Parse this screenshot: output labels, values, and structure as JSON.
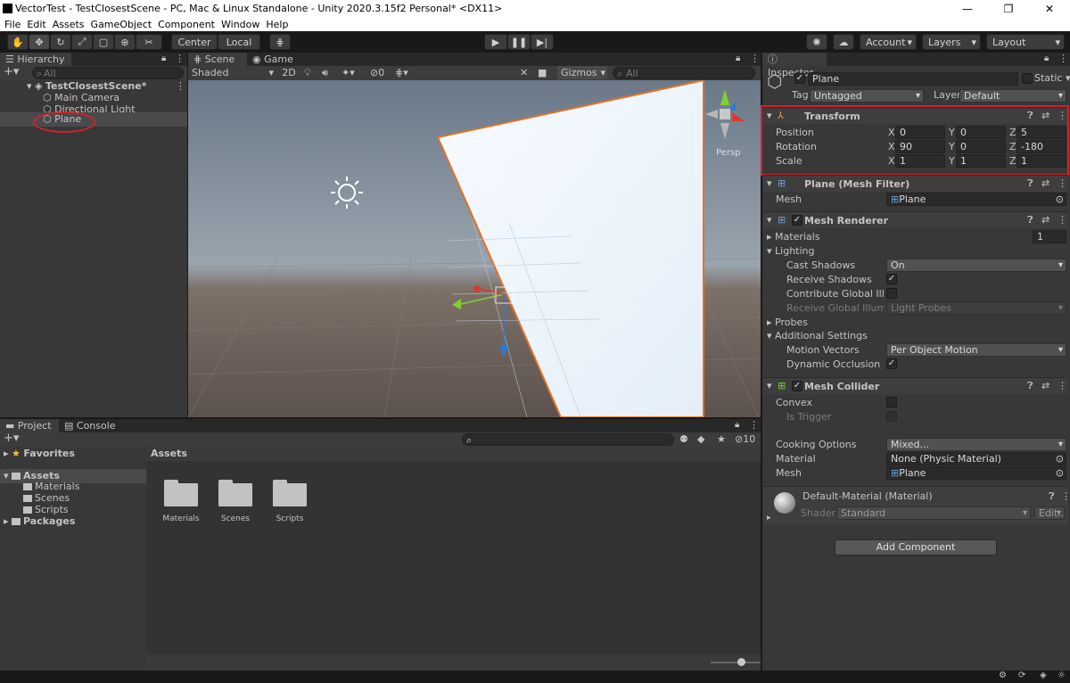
{
  "window": {
    "title": "VectorTest - TestClosestScene - PC, Mac & Linux Standalone - Unity 2020.3.15f2 Personal* <DX11>",
    "controls": [
      "—",
      "❐",
      "✕"
    ]
  },
  "menu": [
    "File",
    "Edit",
    "Assets",
    "GameObject",
    "Component",
    "Window",
    "Help"
  ],
  "toolbar": {
    "pivot": "Center",
    "space": "Local",
    "account": "Account",
    "layers": "Layers",
    "layout": "Layout"
  },
  "hierarchy": {
    "tab": "Hierarchy",
    "search_placeholder": "All",
    "scene": "TestClosestScene*",
    "items": [
      "Main Camera",
      "Directional Light",
      "Plane"
    ]
  },
  "scene_view": {
    "tabs": [
      "Scene",
      "Game"
    ],
    "draw_mode": "Shaded",
    "mode_2d": "2D",
    "hidden_count": "0",
    "gizmos": "Gizmos",
    "search_placeholder": "All",
    "persp": "Persp"
  },
  "project": {
    "tabs": [
      "Project",
      "Console"
    ],
    "hidden_count": "10",
    "favorites": "Favorites",
    "assets": "Assets",
    "asset_folders": [
      "Materials",
      "Scenes",
      "Scripts"
    ],
    "packages": "Packages",
    "breadcrumb": "Assets",
    "grid_items": [
      "Materials",
      "Scenes",
      "Scripts"
    ],
    "zoom_slider": 0.65
  },
  "inspector": {
    "tab": "Inspector",
    "object_name": "Plane",
    "static_label": "Static",
    "tag_label": "Tag",
    "tag_value": "Untagged",
    "layer_label": "Layer",
    "layer_value": "Default",
    "transform": {
      "title": "Transform",
      "position_label": "Position",
      "rotation_label": "Rotation",
      "scale_label": "Scale",
      "position": {
        "x": "0",
        "y": "0",
        "z": "5"
      },
      "rotation": {
        "x": "90",
        "y": "0",
        "z": "-180"
      },
      "scale": {
        "x": "1",
        "y": "1",
        "z": "1"
      }
    },
    "mesh_filter": {
      "title": "Plane (Mesh Filter)",
      "mesh_label": "Mesh",
      "mesh_value": "Plane"
    },
    "mesh_renderer": {
      "title": "Mesh Renderer",
      "materials_label": "Materials",
      "materials_count": "1",
      "lighting_label": "Lighting",
      "cast_shadows_label": "Cast Shadows",
      "cast_shadows_value": "On",
      "receive_shadows_label": "Receive Shadows",
      "contribute_gi_label": "Contribute Global Illumi",
      "receive_gi_label": "Receive Global Illumina",
      "receive_gi_value": "Light Probes",
      "probes_label": "Probes",
      "additional_label": "Additional Settings",
      "motion_vectors_label": "Motion Vectors",
      "motion_vectors_value": "Per Object Motion",
      "dynamic_occlusion_label": "Dynamic Occlusion"
    },
    "mesh_collider": {
      "title": "Mesh Collider",
      "convex_label": "Convex",
      "is_trigger_label": "Is Trigger",
      "cooking_label": "Cooking Options",
      "cooking_value": "Mixed...",
      "material_label": "Material",
      "material_value": "None (Physic Material)",
      "mesh_label": "Mesh",
      "mesh_value": "Plane"
    },
    "material": {
      "title": "Default-Material (Material)",
      "shader_label": "Shader",
      "shader_value": "Standard",
      "edit_label": "Edit..."
    },
    "add_component": "Add Component"
  },
  "axes": {
    "x": "X",
    "y": "Y",
    "z": "Z"
  },
  "colors": {
    "highlight_red": "#d0222a",
    "selection_orange": "#e0722a"
  }
}
